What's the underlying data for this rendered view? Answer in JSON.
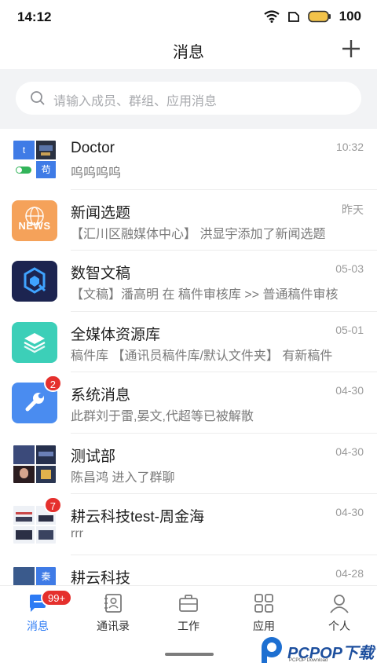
{
  "status_bar": {
    "time": "14:12",
    "battery": "100"
  },
  "nav": {
    "title": "消息"
  },
  "search": {
    "placeholder": "请输入成员、群组、应用消息"
  },
  "conversations": [
    {
      "name": "Doctor",
      "time": "10:32",
      "preview": "呜呜呜呜",
      "avatar_text_1": "t",
      "avatar_text_2": "苟"
    },
    {
      "name": "新闻选题",
      "time": "昨天",
      "preview": "【汇川区融媒体中心】 洪显宇添加了新闻选题",
      "avatar_text_1": "NEWS"
    },
    {
      "name": "数智文稿",
      "time": "05-03",
      "preview": "【文稿】潘高明 在 稿件审核库 >> 普通稿件审核"
    },
    {
      "name": "全媒体资源库",
      "time": "05-01",
      "preview": "稿件库 【通讯员稿件库/默认文件夹】 有新稿件"
    },
    {
      "name": "系统消息",
      "time": "04-30",
      "preview": "此群刘于雷,晏文,代超等已被解散",
      "badge": "2"
    },
    {
      "name": "测试部",
      "time": "04-30",
      "preview": "陈昌鸿 进入了群聊"
    },
    {
      "name": "耕云科技test-周金海",
      "time": "04-30",
      "preview": "rrr",
      "badge": "7"
    },
    {
      "name": "耕云科技",
      "time": "04-28",
      "preview": "",
      "avatar_text_1": "秦"
    }
  ],
  "tabs": [
    {
      "label": "消息",
      "active": true,
      "badge": "99+"
    },
    {
      "label": "通讯录"
    },
    {
      "label": "工作"
    },
    {
      "label": "应用"
    },
    {
      "label": "个人"
    }
  ],
  "colors": {
    "accent": "#2d7bf4",
    "badge": "#e5302d",
    "search_bg": "#f2f3f5"
  },
  "watermark": {
    "brand": "PCPOP下载",
    "sub": "PCPOP Download"
  }
}
